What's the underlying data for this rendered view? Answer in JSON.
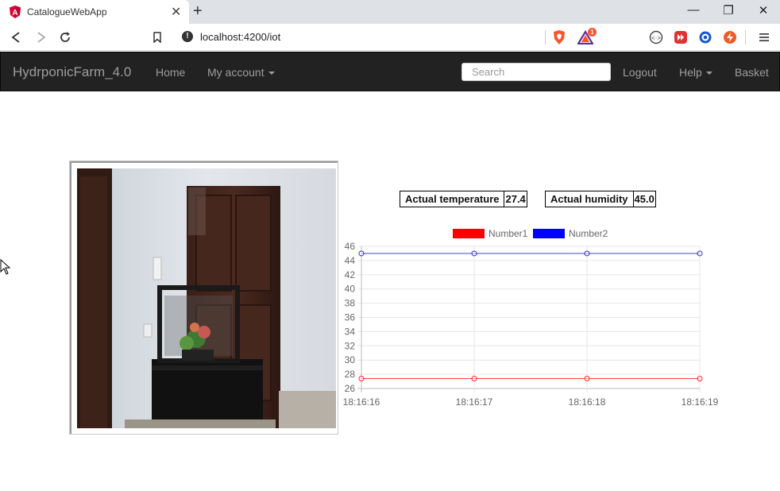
{
  "browser": {
    "tab_title": "CatalogueWebApp",
    "url": "localhost:4200/iot",
    "badge_count": "1"
  },
  "navbar": {
    "brand": "HydrponicFarm_4.0",
    "home": "Home",
    "my_account": "My account",
    "search_placeholder": "Search",
    "logout": "Logout",
    "help": "Help",
    "basket": "Basket"
  },
  "readings": {
    "temperature_label": "Actual temperature",
    "temperature_value": "27.4",
    "humidity_label": "Actual humidity",
    "humidity_value": "45.0"
  },
  "colors": {
    "navbar_bg": "#222222",
    "series1": "#ff0000",
    "series2": "#0000ff"
  },
  "chart_data": {
    "type": "line",
    "x": [
      "18:16:16",
      "18:16:17",
      "18:16:18",
      "18:16:19"
    ],
    "series": [
      {
        "name": "Number1",
        "color": "#ff0000",
        "values": [
          27.4,
          27.4,
          27.4,
          27.4
        ]
      },
      {
        "name": "Number2",
        "color": "#0000ff",
        "values": [
          45.0,
          45.0,
          45.0,
          45.0
        ]
      }
    ],
    "ylim": [
      26,
      46
    ],
    "yticks": [
      26,
      28,
      30,
      32,
      34,
      36,
      38,
      40,
      42,
      44,
      46
    ],
    "legend": "top",
    "grid": true
  }
}
